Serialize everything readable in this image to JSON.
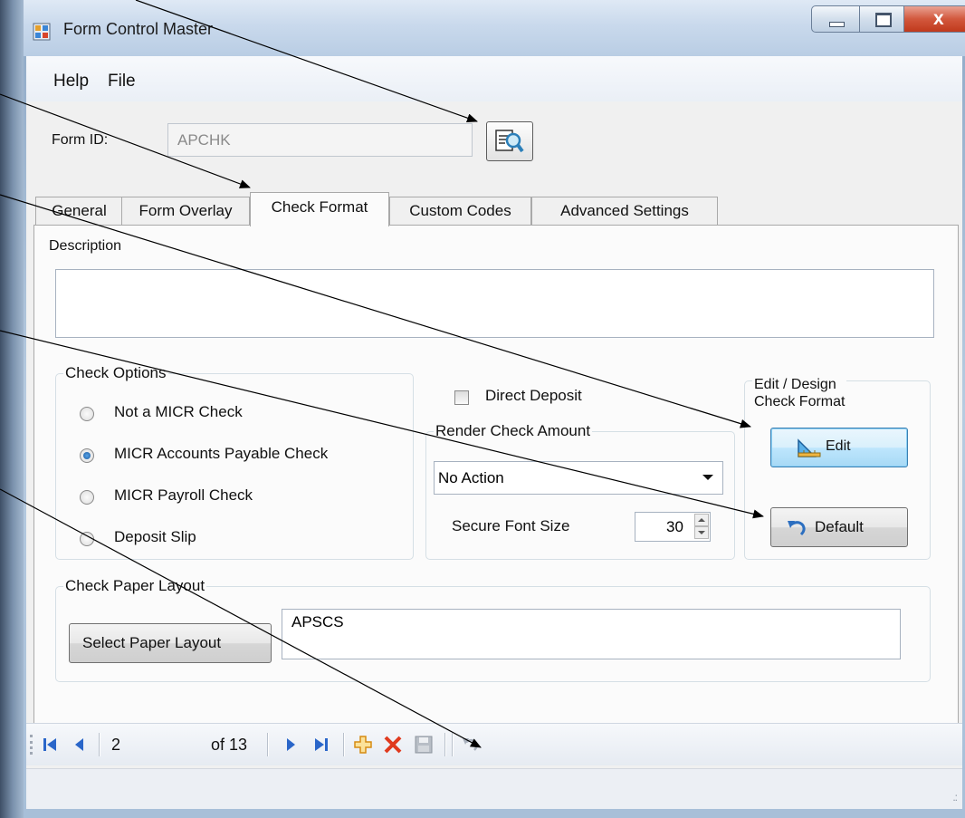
{
  "window": {
    "title": "Form Control Master"
  },
  "menu": {
    "items": [
      "Help",
      "File"
    ]
  },
  "form": {
    "form_id_label": "Form ID:",
    "form_id_value": "APCHK"
  },
  "tabs": [
    "General",
    "Form Overlay",
    "Check Format",
    "Custom Codes",
    "Advanced Settings"
  ],
  "active_tab": "Check Format",
  "check_format": {
    "description_label": "Description",
    "description_value": "",
    "check_options": {
      "title": "Check Options",
      "options": [
        "Not a MICR Check",
        "MICR Accounts Payable Check",
        "MICR Payroll Check",
        "Deposit Slip"
      ],
      "selected": "MICR Accounts Payable Check"
    },
    "direct_deposit": {
      "label": "Direct Deposit",
      "checked": false
    },
    "render_amount": {
      "title": "Render Check Amount",
      "selected": "No Action",
      "secure_font_label": "Secure Font Size",
      "secure_font_value": "30"
    },
    "edit_design": {
      "title_line1": "Edit / Design",
      "title_line2": "Check Format",
      "edit_label": "Edit",
      "default_label": "Default"
    },
    "paper_layout": {
      "title": "Check Paper Layout",
      "button_label": "Select Paper Layout",
      "value": "APSCS"
    }
  },
  "navigator": {
    "position": "2",
    "count_text": "of 13"
  },
  "colors": {
    "accent": "#3c7fb1",
    "delete": "#e03a1e",
    "add": "#f0a92a",
    "nav": "#2a66c9"
  },
  "icons": [
    "window-icon",
    "lookup-icon",
    "edit-ruler-icon",
    "undo-icon",
    "move-first-icon",
    "move-previous-icon",
    "move-next-icon",
    "move-last-icon",
    "add-new-icon",
    "delete-icon",
    "save-icon",
    "undo-toolbar-icon"
  ]
}
